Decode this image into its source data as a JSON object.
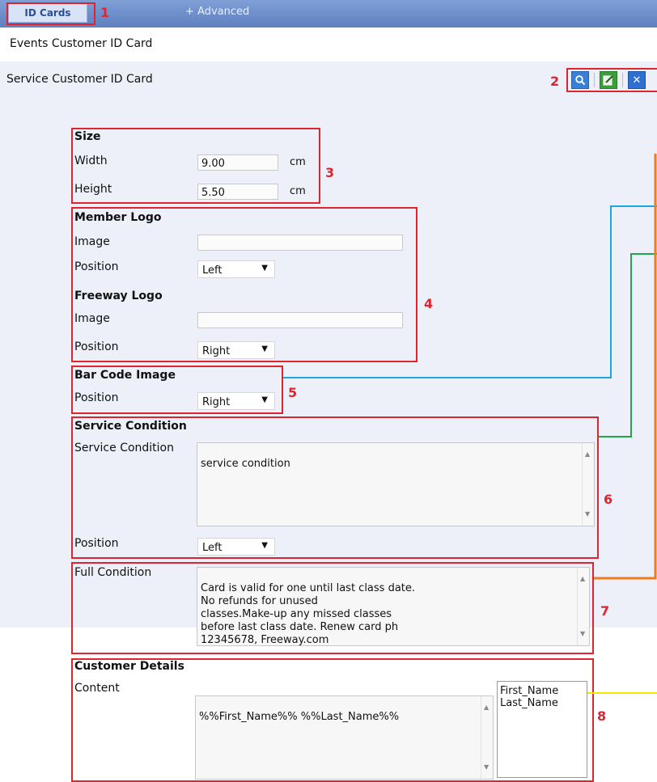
{
  "tabs": {
    "id_cards": "ID Cards",
    "advanced": "+ Advanced"
  },
  "page": {
    "events_title": "Events Customer ID Card",
    "service_title": "Service Customer ID Card"
  },
  "toolbar": {
    "search_icon": "search-icon",
    "edit_icon": "edit-icon",
    "close_icon": "close-icon"
  },
  "annotations": [
    "1",
    "2",
    "3",
    "4",
    "5",
    "6",
    "7",
    "8"
  ],
  "size": {
    "header": "Size",
    "width_label": "Width",
    "width_value": "9.00",
    "height_label": "Height",
    "height_value": "5.50",
    "unit": "cm"
  },
  "member_logo": {
    "header": "Member Logo",
    "image_label": "Image",
    "image_value": "",
    "position_label": "Position",
    "position_value": "Left"
  },
  "freeway_logo": {
    "header": "Freeway Logo",
    "image_label": "Image",
    "image_value": "",
    "position_label": "Position",
    "position_value": "Right"
  },
  "barcode": {
    "header": "Bar Code Image",
    "position_label": "Position",
    "position_value": "Right"
  },
  "service_condition": {
    "header": "Service Condition",
    "label": "Service Condition",
    "value": "service condition",
    "position_label": "Position",
    "position_value": "Left"
  },
  "full_condition": {
    "label": "Full Condition",
    "value": "Card is valid for one until last class date.\nNo refunds for unused\nclasses.Make-up any missed classes\nbefore last class date. Renew card ph\n12345678, Freeway.com"
  },
  "customer_details": {
    "header": "Customer Details",
    "content_label": "Content",
    "content_value": "%%First_Name%% %%Last_Name%%",
    "fields": [
      "First_Name",
      "Last_Name"
    ]
  },
  "colors": {
    "annotation_red": "#e0242f",
    "wire_blue": "#1aa7e0",
    "wire_green": "#1fa74a",
    "wire_orange": "#f07a1d",
    "wire_yellow": "#f3e600"
  }
}
